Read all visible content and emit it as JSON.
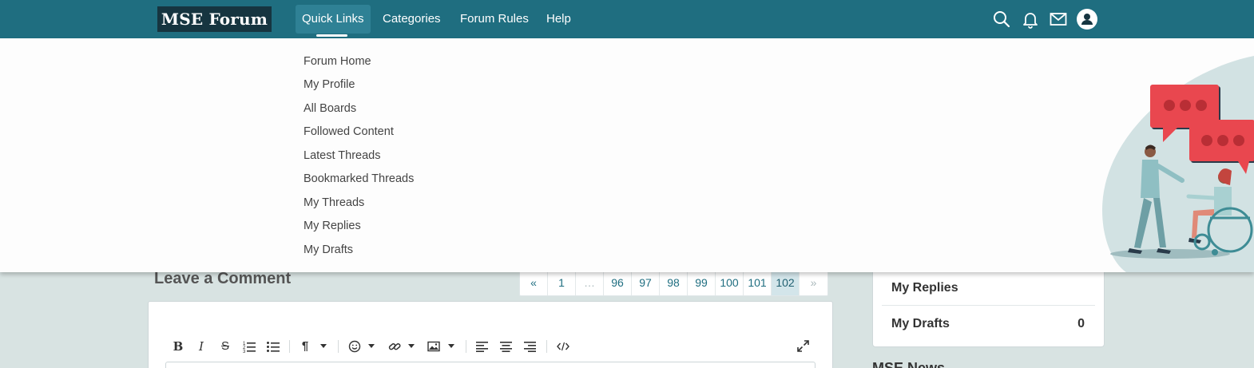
{
  "header": {
    "logo": "MSE Forum",
    "nav": [
      {
        "label": "Quick Links"
      },
      {
        "label": "Categories"
      },
      {
        "label": "Forum Rules"
      },
      {
        "label": "Help"
      }
    ],
    "icons": [
      "search-icon",
      "bell-icon",
      "mail-icon",
      "user-avatar-icon"
    ],
    "colors": {
      "bar": "#1f6e80",
      "logo_bg": "#163540",
      "active_tab": "#2f8195"
    }
  },
  "quick_links": {
    "items": [
      "Forum Home",
      "My Profile",
      "All Boards",
      "Followed Content",
      "Latest Threads",
      "Bookmarked Threads",
      "My Threads",
      "My Replies",
      "My Drafts"
    ]
  },
  "comment": {
    "title": "Leave a Comment"
  },
  "pagination": {
    "prev": "«",
    "pages": [
      "1",
      "…",
      "96",
      "97",
      "98",
      "99",
      "100",
      "101",
      "102"
    ],
    "current": "102",
    "next": "»"
  },
  "editor": {
    "toolbar": [
      "B",
      "I",
      "S",
      "numbered-list-icon",
      "bullet-list-icon",
      "¶",
      "emoji-icon",
      "link-icon",
      "image-icon",
      "align-left-icon",
      "align-center-icon",
      "align-right-icon",
      "code-icon",
      "fullscreen-icon"
    ]
  },
  "sidebar": {
    "rows": [
      {
        "label": "My Replies",
        "count": ""
      },
      {
        "label": "My Drafts",
        "count": "0"
      }
    ],
    "next_heading": "MSE News"
  }
}
